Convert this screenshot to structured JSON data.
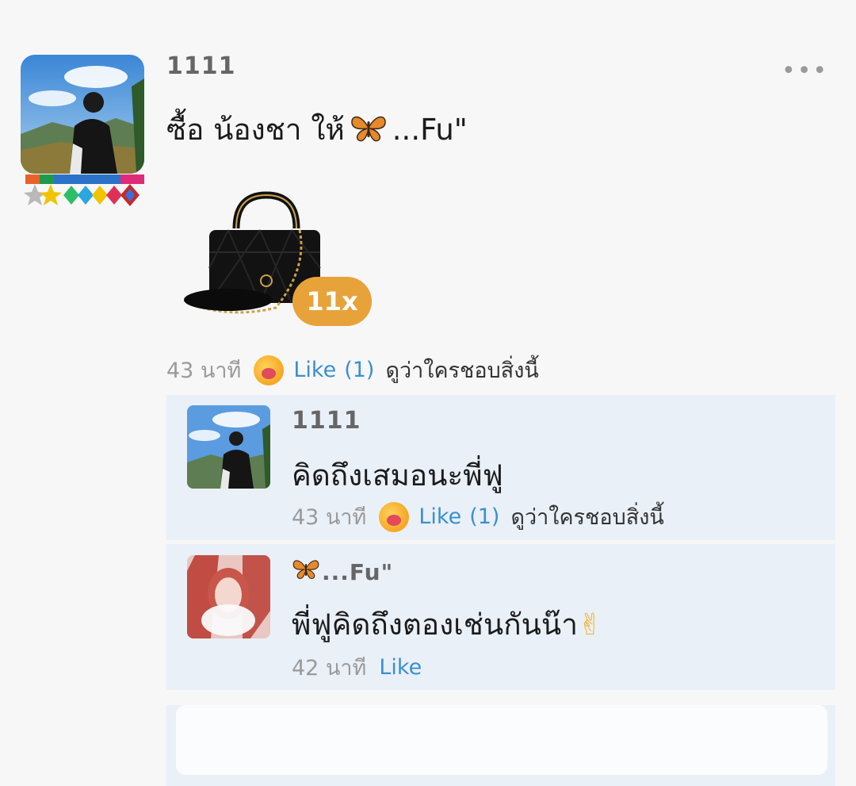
{
  "post": {
    "username": "1111",
    "more_label": "•••",
    "text_before": "ซื้อ น้องชา ให้",
    "text_after": "...Fu\"",
    "gift_count": "11x",
    "time": "43 นาที",
    "like_label": "Like",
    "like_count": "(1)",
    "who_liked": "ดูว่าใครชอบสิ่งนี้"
  },
  "comments": [
    {
      "username": "1111",
      "text": "คิดถึงเสมอนะพี่ฟู",
      "time": "43 นาที",
      "like_label": "Like",
      "like_count": "(1)",
      "who_liked": "ดูว่าใครชอบสิ่งนี้"
    },
    {
      "username": "...Fu\"",
      "text": "พี่ฟูคิดถึงตองเช่นกันน๊า",
      "text_emoji": "✌",
      "time": "42 นาที",
      "like_label": "Like"
    }
  ],
  "colors": {
    "accent_link": "#3b8fcf",
    "gift_badge": "#e8a23a",
    "comment_bg": "#e9f0f8"
  },
  "icons": [
    "more-icon",
    "butterfly-icon",
    "handbag-gift-icon",
    "love-reaction-icon",
    "victory-hand-icon"
  ]
}
